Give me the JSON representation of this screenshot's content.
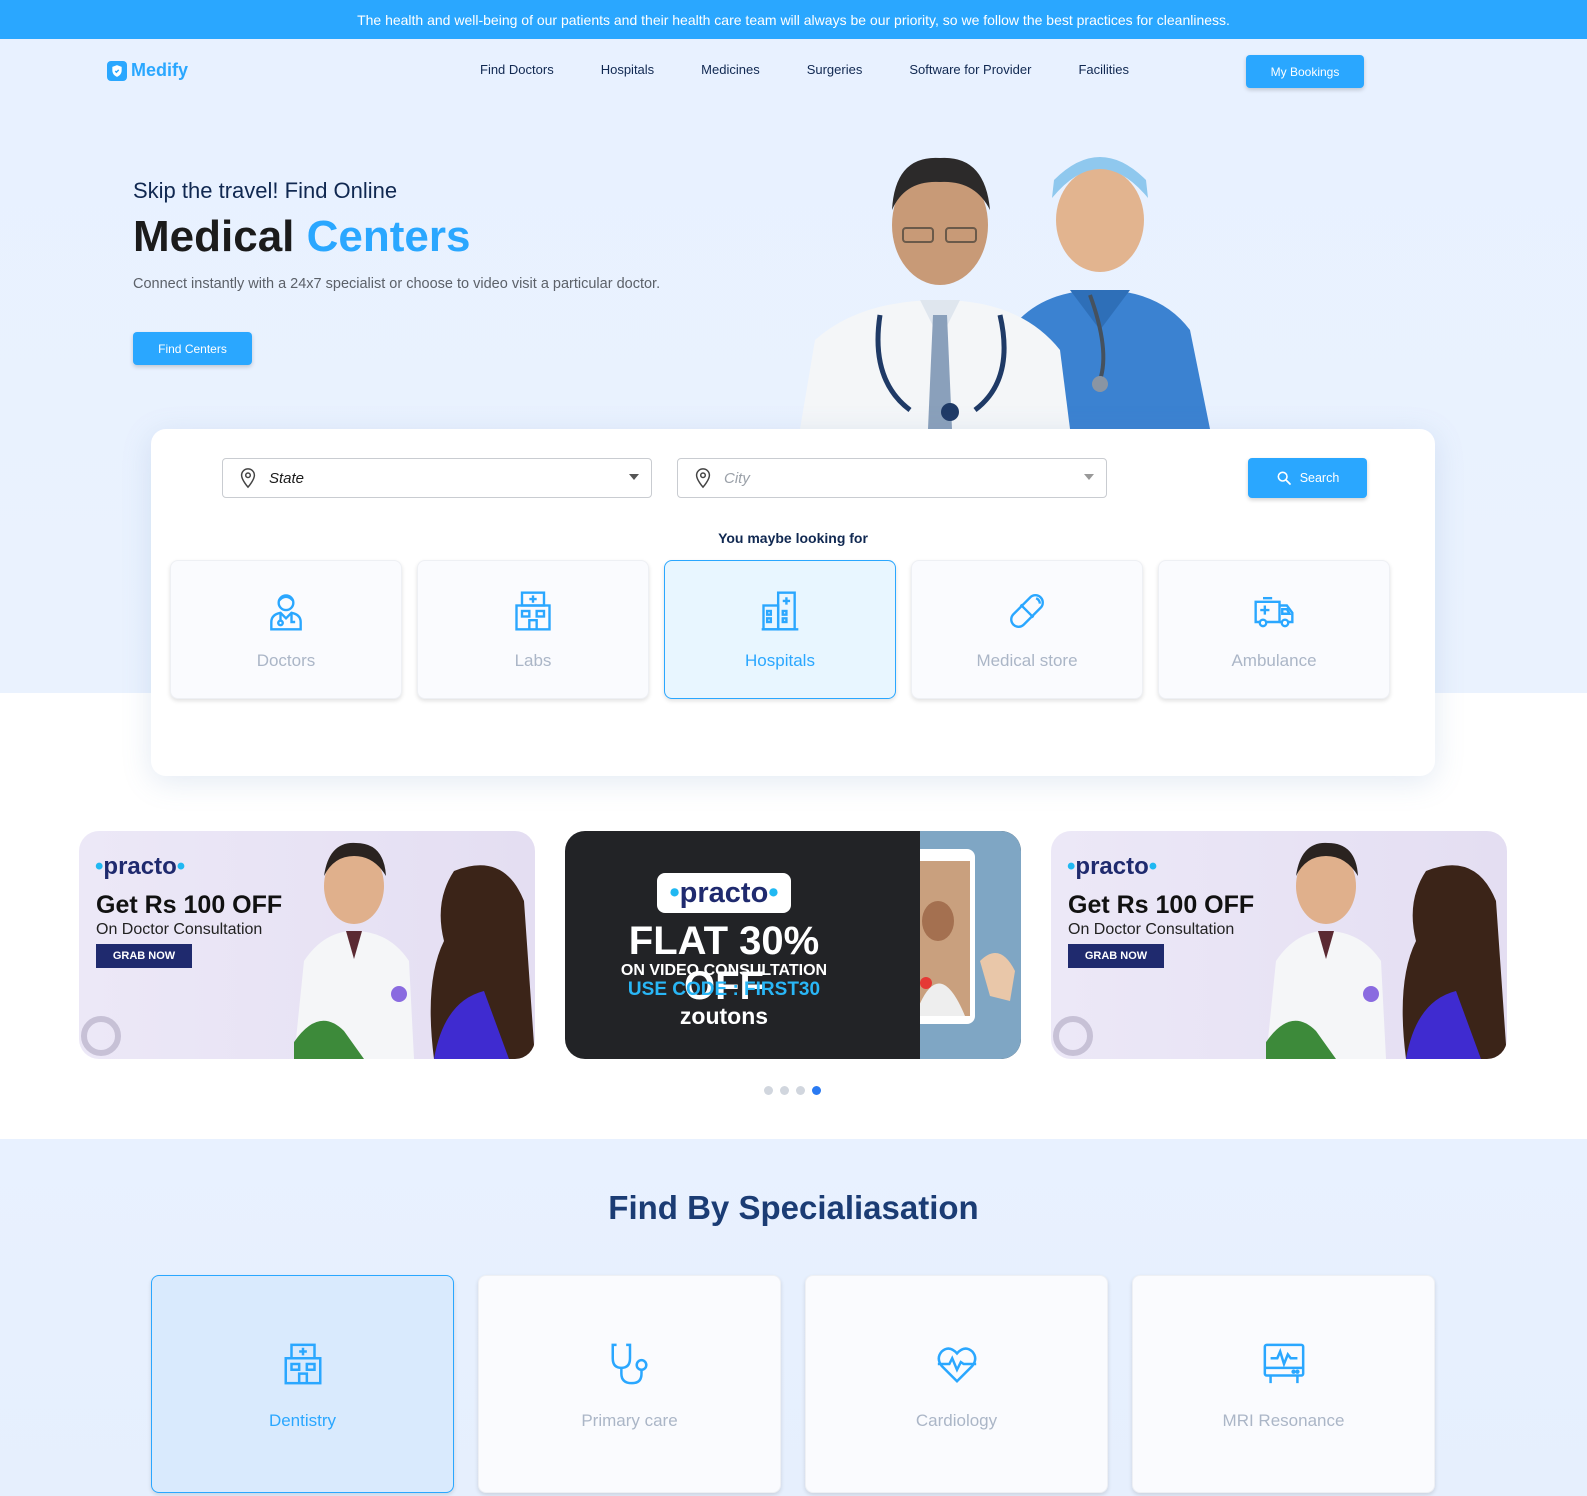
{
  "announcement": "The health and well-being of our patients and their health care team will always be our priority, so we follow the best practices for cleanliness.",
  "brand": {
    "name": "Medify",
    "accent": "#2aa7ff"
  },
  "nav": {
    "links": [
      "Find Doctors",
      "Hospitals",
      "Medicines",
      "Surgeries",
      "Software for Provider",
      "Facilities"
    ],
    "cta": "My Bookings"
  },
  "hero": {
    "subtitle": "Skip the travel! Find Online",
    "title_main": "Medical",
    "title_accent": "Centers",
    "description": "Connect instantly with a 24x7 specialist or choose to video visit a particular doctor.",
    "button": "Find Centers"
  },
  "search": {
    "state_value": "State",
    "city_placeholder": "City",
    "button": "Search",
    "looking_for_title": "You maybe looking for",
    "categories": [
      {
        "label": "Doctors",
        "icon": "doctor-icon",
        "active": false
      },
      {
        "label": "Labs",
        "icon": "lab-icon",
        "active": false
      },
      {
        "label": "Hospitals",
        "icon": "hospital-icon",
        "active": true
      },
      {
        "label": "Medical store",
        "icon": "capsule-icon",
        "active": false
      },
      {
        "label": "Ambulance",
        "icon": "ambulance-icon",
        "active": false
      }
    ]
  },
  "offers": [
    {
      "brand": "practo",
      "headline": "Get Rs 100 OFF",
      "subline": "On Doctor Consultation",
      "cta": "GRAB NOW"
    },
    {
      "brand": "practo",
      "headline": "FLAT 30% OFF",
      "subline": "ON VIDEO CONSULTATION",
      "code": "USE CODE : FIRST30",
      "partner": "zoutons"
    },
    {
      "brand": "practo",
      "headline": "Get Rs 100 OFF",
      "subline": "On Doctor Consultation",
      "cta": "GRAB NOW"
    }
  ],
  "carousel": {
    "count": 4,
    "active_index": 3
  },
  "specialisation": {
    "title": "Find By Specialiasation",
    "items": [
      {
        "label": "Dentistry",
        "icon": "hospital-building-icon",
        "active": true
      },
      {
        "label": "Primary care",
        "icon": "stethoscope-icon",
        "active": false
      },
      {
        "label": "Cardiology",
        "icon": "heart-pulse-icon",
        "active": false
      },
      {
        "label": "MRI Resonance",
        "icon": "monitor-pulse-icon",
        "active": false
      }
    ]
  }
}
